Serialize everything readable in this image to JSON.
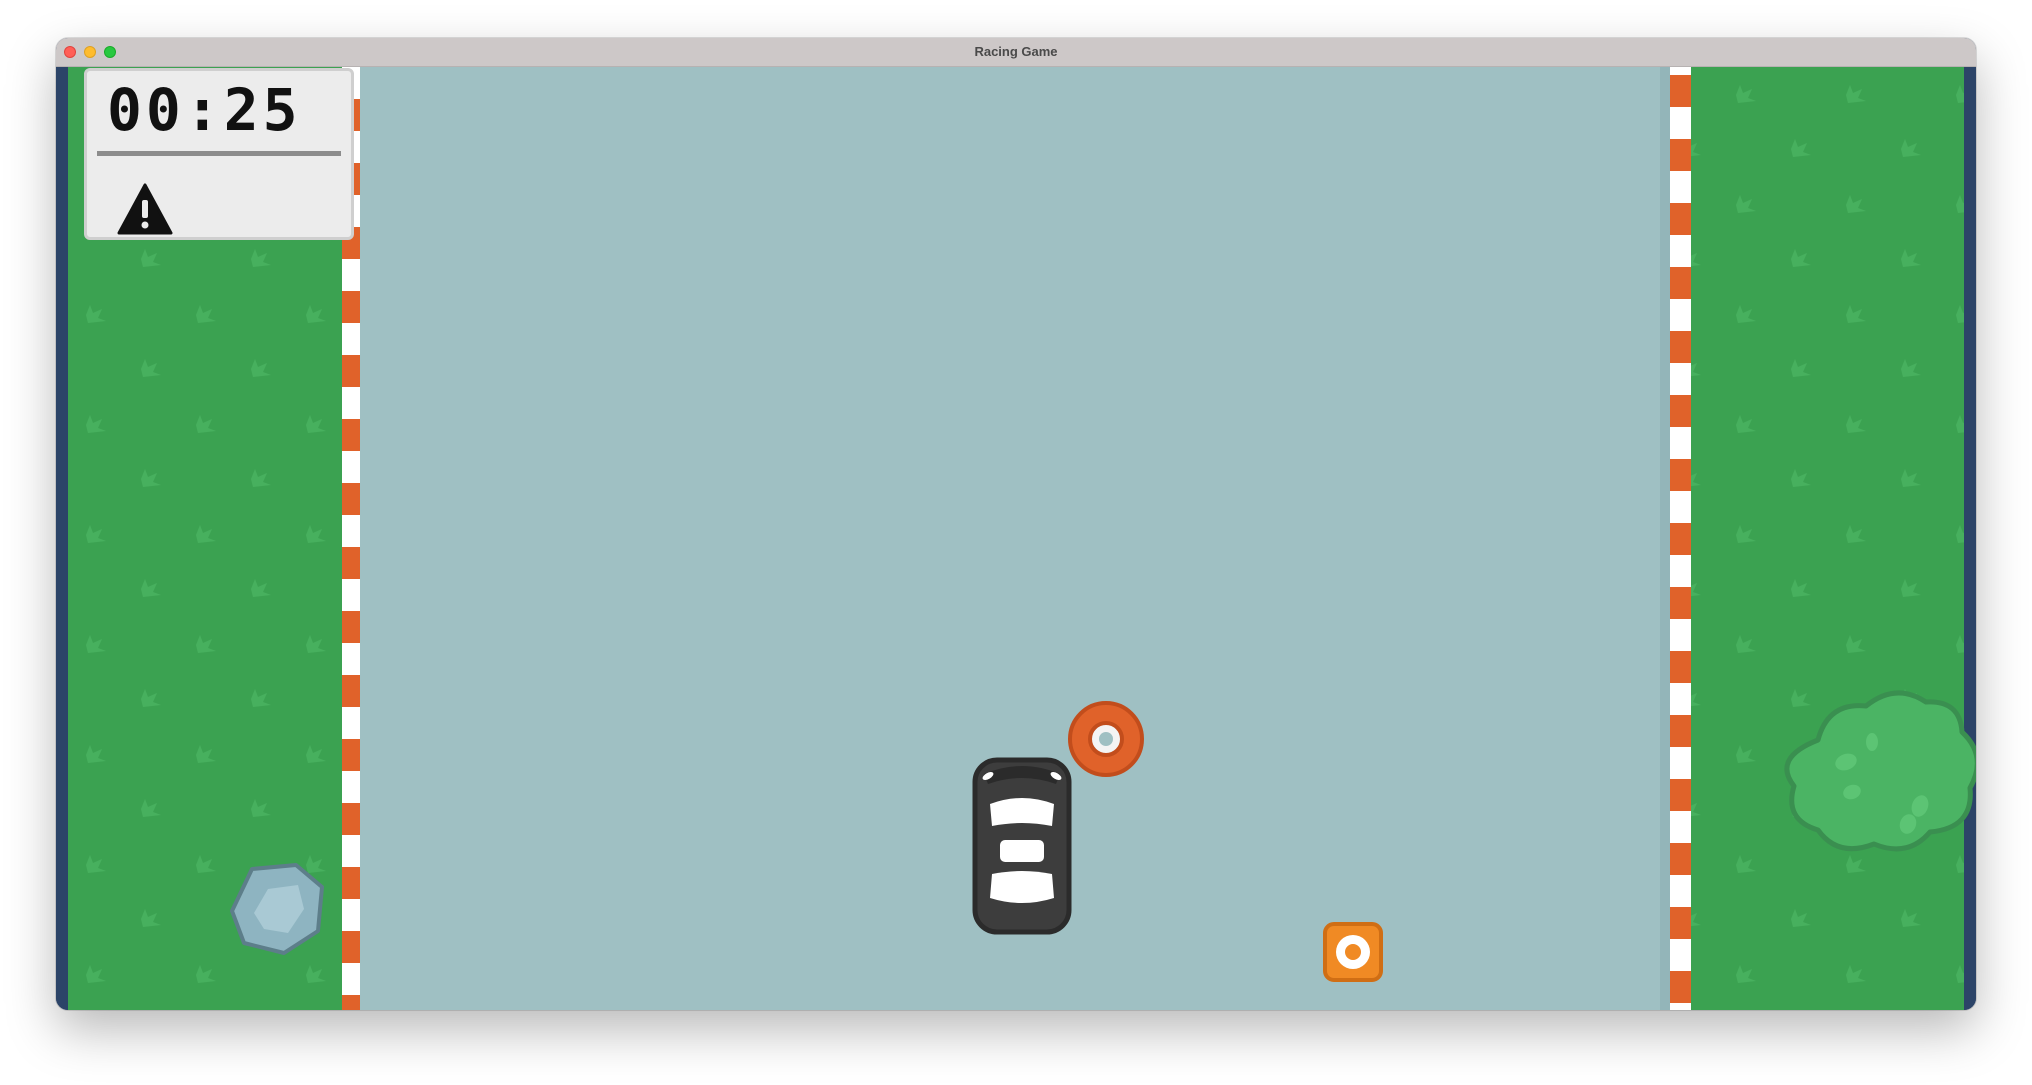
{
  "window": {
    "title": "Racing Game"
  },
  "hud": {
    "timer": "00:25",
    "warning_icon": "warning-triangle-icon"
  },
  "colors": {
    "grass": "#3ba251",
    "grass_star": "#47b05e",
    "road": "#9fc0c3",
    "curb_orange": "#e0622a",
    "curb_white": "#ffffff",
    "frame": "#2c4468",
    "car_body": "#3d3d3d",
    "cone": "#e0622a",
    "powerup": "#f08a24",
    "rock": "#8eb4c1",
    "bush": "#4bb464",
    "hud_bg": "#ececec"
  },
  "objects": {
    "player": "player-car-icon",
    "obstacle_1": "traffic-cone-icon",
    "pickup_1": "powerup-box-icon",
    "scenery_1": "rock-icon",
    "scenery_2": "bush-icon"
  }
}
